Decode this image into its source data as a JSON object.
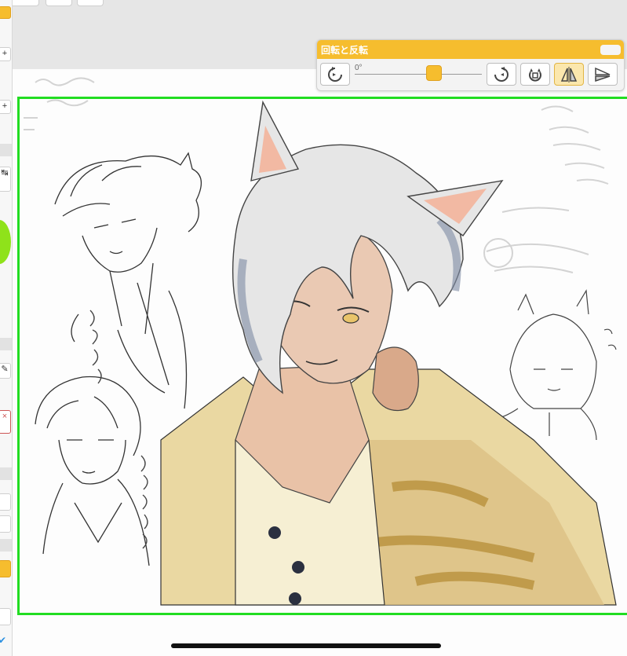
{
  "rotate_panel": {
    "title": "回転と反転",
    "angle": "0°",
    "rotation_level": 0.5,
    "buttons": [
      {
        "name": "rotate-left",
        "icon": "rotate-ccw-icon"
      },
      {
        "name": "rotate-right",
        "icon": "rotate-cw-icon"
      },
      {
        "name": "reset-rotation",
        "icon": "reset-rotation-icon"
      },
      {
        "name": "flip-horizontal",
        "icon": "flip-horizontal-icon",
        "active": true
      },
      {
        "name": "flip-vertical",
        "icon": "flip-vertical-icon"
      }
    ]
  },
  "left_toolbar": {
    "items": [
      "+",
      "+",
      "↹",
      "✎",
      "×"
    ]
  },
  "colors": {
    "accent": "#f6bd2e",
    "selection_border": "#22dd22",
    "active_button": "#fbe7ad"
  }
}
